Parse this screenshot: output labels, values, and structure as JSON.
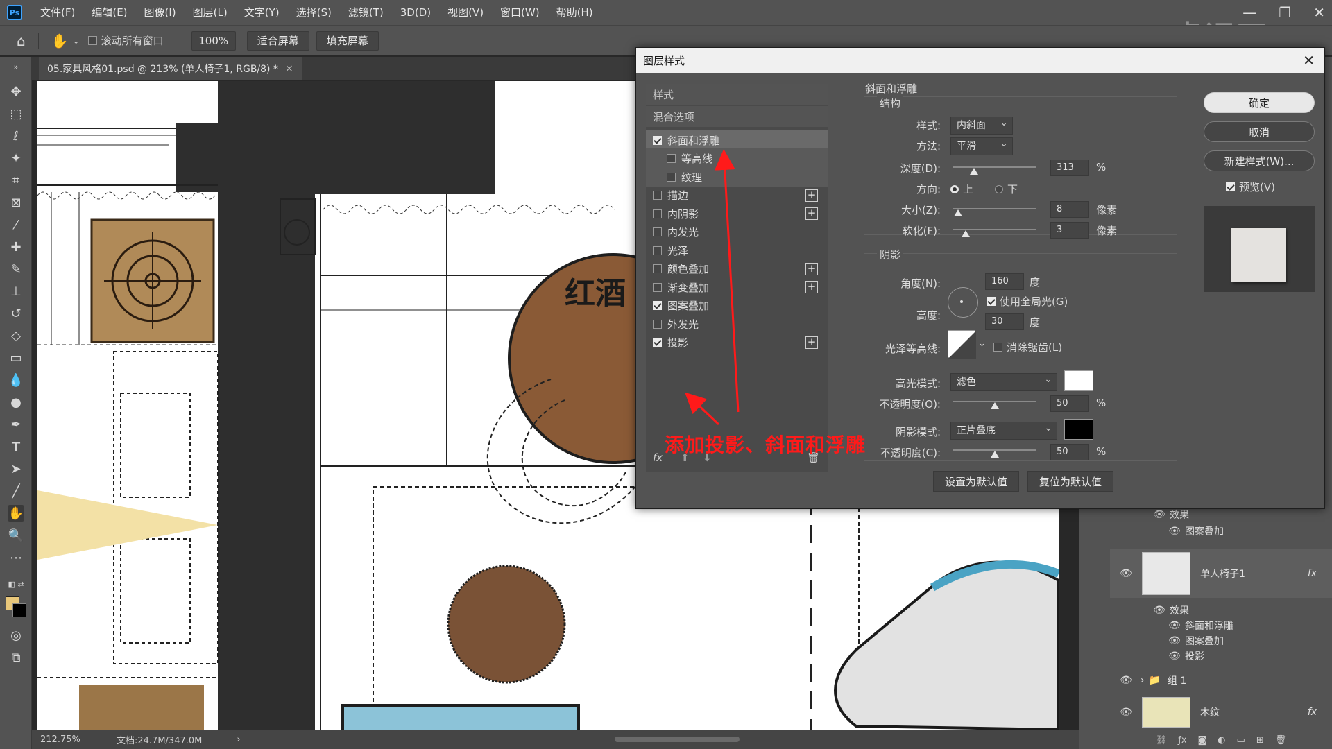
{
  "app": {
    "logo": "Ps",
    "menu": [
      "文件(F)",
      "编辑(E)",
      "图像(I)",
      "图层(L)",
      "文字(Y)",
      "选择(S)",
      "滤镜(T)",
      "3D(D)",
      "视图(V)",
      "窗口(W)",
      "帮助(H)"
    ],
    "window_controls": [
      "—",
      "❐",
      "✕"
    ],
    "watermark": "虎课网"
  },
  "options": {
    "scroll_all_label": "滚动所有窗口",
    "zoom_value": "100%",
    "fit_screen": "适合屏幕",
    "fill_screen": "填充屏幕"
  },
  "document": {
    "tab_title": "05.家具风格01.psd @ 213% (单人椅子1, RGB/8) *",
    "tab_close": "×",
    "canvas_text": "红酒"
  },
  "status": {
    "zoom": "212.75%",
    "doc_size": "文档:24.7M/347.0M",
    "arrow": "›"
  },
  "dialog": {
    "title": "图层样式",
    "close": "✕",
    "styles_header": "样式",
    "blend_options": "混合选项",
    "style_items": [
      {
        "label": "斜面和浮雕",
        "checked": true,
        "plus": false
      },
      {
        "label": "等高线",
        "checked": false,
        "plus": false
      },
      {
        "label": "纹理",
        "checked": false,
        "plus": false
      },
      {
        "label": "描边",
        "checked": false,
        "plus": true
      },
      {
        "label": "内阴影",
        "checked": false,
        "plus": true
      },
      {
        "label": "内发光",
        "checked": false,
        "plus": false
      },
      {
        "label": "光泽",
        "checked": false,
        "plus": false
      },
      {
        "label": "颜色叠加",
        "checked": false,
        "plus": true
      },
      {
        "label": "渐变叠加",
        "checked": false,
        "plus": true
      },
      {
        "label": "图案叠加",
        "checked": true,
        "plus": false
      },
      {
        "label": "外发光",
        "checked": false,
        "plus": false
      },
      {
        "label": "投影",
        "checked": true,
        "plus": true
      }
    ],
    "footer_fx": "fx",
    "section_title": "斜面和浮雕",
    "structure": {
      "title": "结构",
      "style_label": "样式:",
      "style_value": "内斜面",
      "method_label": "方法:",
      "method_value": "平滑",
      "depth_label": "深度(D):",
      "depth_value": "313",
      "depth_unit": "%",
      "depth_fraction": 0.25,
      "direction_label": "方向:",
      "direction_up": "上",
      "direction_down": "下",
      "size_label": "大小(Z):",
      "size_value": "8",
      "size_unit": "像素",
      "size_fraction": 0.06,
      "soften_label": "软化(F):",
      "soften_value": "3",
      "soften_unit": "像素",
      "soften_fraction": 0.15
    },
    "shading": {
      "title": "阴影",
      "angle_label": "角度(N):",
      "angle_value": "160",
      "angle_unit": "度",
      "global_light": "使用全局光(G)",
      "altitude_label": "高度:",
      "altitude_value": "30",
      "altitude_unit": "度",
      "gloss_label": "光泽等高线:",
      "antialias": "消除锯齿(L)",
      "highlight_label": "高光模式:",
      "highlight_value": "滤色",
      "highlight_color": "#ffffff",
      "hl_opacity_label": "不透明度(O):",
      "hl_opacity_value": "50",
      "hl_opacity_unit": "%",
      "hl_opacity_fraction": 0.5,
      "shadow_label": "阴影模式:",
      "shadow_value": "正片叠底",
      "shadow_color": "#000000",
      "sh_opacity_label": "不透明度(C):",
      "sh_opacity_value": "50",
      "sh_opacity_unit": "%",
      "sh_opacity_fraction": 0.5
    },
    "make_default": "设置为默认值",
    "reset_default": "复位为默认值",
    "ok": "确定",
    "cancel": "取消",
    "new_style": "新建样式(W)...",
    "preview": "预览(V)"
  },
  "annotation": "添加投影、斜面和浮雕",
  "layers": {
    "effects_label": "效果",
    "pattern_overlay": "图案叠加",
    "chair_layer": "单人椅子1",
    "chair_fx": "fx",
    "chair_effects": [
      "斜面和浮雕",
      "图案叠加",
      "投影"
    ],
    "group1": "组 1",
    "wood_layer": "木纹",
    "wood_fx": "fx"
  }
}
